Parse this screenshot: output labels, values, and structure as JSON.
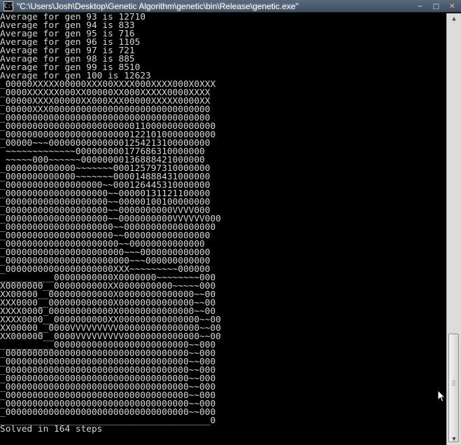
{
  "window": {
    "title": "\"C:\\Users\\Josh\\Desktop\\Genetic Algorithm\\genetic\\bin\\Release\\genetic.exe\"",
    "app_icon": "console-icon",
    "buttons": [
      {
        "name": "minimize",
        "icon": "minimize-icon",
        "glyph": "−"
      },
      {
        "name": "maximize",
        "icon": "maximize-icon",
        "glyph": "□"
      },
      {
        "name": "close",
        "icon": "close-icon",
        "glyph": "✕"
      }
    ]
  },
  "console": {
    "lines": [
      "Average for gen 93 is 12710",
      "Average for gen 94 is 833",
      "Average for gen 95 is 716",
      "Average for gen 96 is 1105",
      "Average for gen 97 is 721",
      "Average for gen 98 is 885",
      "Average for gen 99 is 8510",
      "Average for gen 100 is 12623",
      "_00000XXXXX00000XXX00XXXX000XXXX000X0XXX",
      "_0000XXXXXX000XX00000XX000XXXXX0000XXXX",
      "_00000XXXX00000XX000XXX00000XXXXX0000XX",
      "_00000XXX000000000000000000000000000000",
      "_00000000000000000000000000000000000000",
      "_000000000000000000000000110000000000000",
      "_000000000000000000000001221010000000000",
      "_00000~~~000000000000001254213100000000",
      " ~~~~~~~~~~~~~000000000177686310000000",
      " ~~~~~000~~~~~~00000000136888421000000",
      "_0000000000000~~~~~~~000125797310000000",
      "_0000000000000~~~~~~~000014888431000000",
      "_000000000000000000~~000126445310000000",
      "_0000000000000000000~~00000131121100000",
      "_0000000000000000000~~00000100100000000",
      "_0000000000000000000~~0000000000VVVV000",
      "_0000000000000000000~~0000000000VVVVVV000",
      "_00000000000000000000~~00000000000000000",
      "_00000000000000000000~~0000000000000000",
      "_000000000000000000000~~00000000000000",
      "_0000000000000000000000~~~0000000000000",
      "_00000000000000000000000~~~000000000000",
      "_00000000000000000000XXX~~~~~~~~~000000",
      "__________00000000000X0000000~~~~~~~~000",
      "X0000000__0000000000XX0000000000~~~~~000",
      "XX00000__000000000000X00000000000000~~00",
      "XXX0000__000000000000X00000000000000~~00",
      "XXXX0000_000000000000X00000000000000~~00",
      "XXXX0000__0000000000XX000000000000000~~00",
      "XX00000__0000VVVVVVVVV000000000000000~~00",
      "XX000000__0000VVVVVVVVV00000000000000~~00",
      "__________0000000000000000000000000~~000",
      "_0000000000000000000000000000000000~~000",
      "_0000000000000000000000000000000000~~000",
      "_0000000000000000000000000000000000~~000",
      "_0000000000000000000000000000000000~~000",
      "_0000000000000000000000000000000000~~000",
      "_0000000000000000000000000000000000~~000",
      "_0000000000000000000000000000000000~~000",
      "_0000000000000000000000000000000000~~000",
      "_______________________________________0",
      "Solved in 164 steps"
    ]
  },
  "scrollbar": {
    "up_arrow": "scroll-up-arrow-icon",
    "down_arrow": "scroll-down-arrow-icon",
    "position_fraction": 0.96
  },
  "cursor": {
    "icon": "mouse-pointer-icon"
  }
}
